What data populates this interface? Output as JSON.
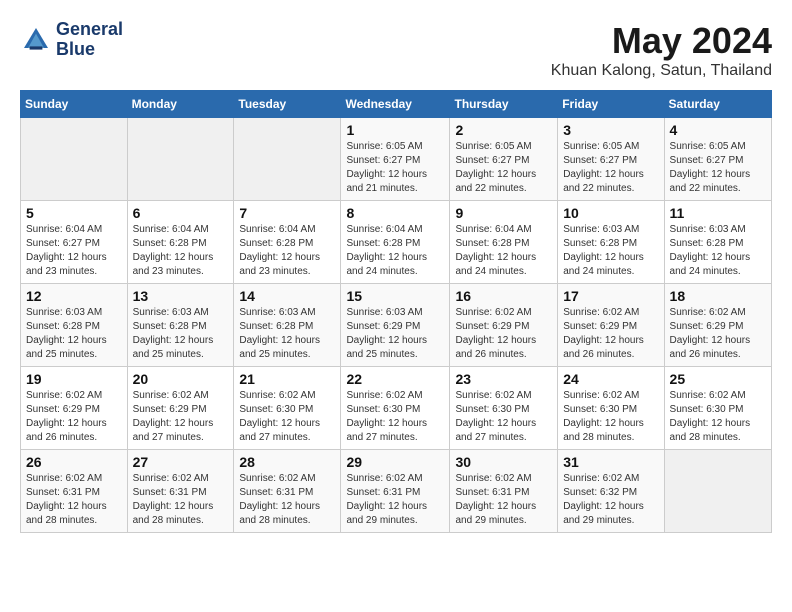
{
  "logo": {
    "line1": "General",
    "line2": "Blue"
  },
  "title": "May 2024",
  "location": "Khuan Kalong, Satun, Thailand",
  "days_of_week": [
    "Sunday",
    "Monday",
    "Tuesday",
    "Wednesday",
    "Thursday",
    "Friday",
    "Saturday"
  ],
  "weeks": [
    [
      {
        "day": "",
        "sunrise": "",
        "sunset": "",
        "daylight": ""
      },
      {
        "day": "",
        "sunrise": "",
        "sunset": "",
        "daylight": ""
      },
      {
        "day": "",
        "sunrise": "",
        "sunset": "",
        "daylight": ""
      },
      {
        "day": "1",
        "sunrise": "Sunrise: 6:05 AM",
        "sunset": "Sunset: 6:27 PM",
        "daylight": "Daylight: 12 hours and 21 minutes."
      },
      {
        "day": "2",
        "sunrise": "Sunrise: 6:05 AM",
        "sunset": "Sunset: 6:27 PM",
        "daylight": "Daylight: 12 hours and 22 minutes."
      },
      {
        "day": "3",
        "sunrise": "Sunrise: 6:05 AM",
        "sunset": "Sunset: 6:27 PM",
        "daylight": "Daylight: 12 hours and 22 minutes."
      },
      {
        "day": "4",
        "sunrise": "Sunrise: 6:05 AM",
        "sunset": "Sunset: 6:27 PM",
        "daylight": "Daylight: 12 hours and 22 minutes."
      }
    ],
    [
      {
        "day": "5",
        "sunrise": "Sunrise: 6:04 AM",
        "sunset": "Sunset: 6:27 PM",
        "daylight": "Daylight: 12 hours and 23 minutes."
      },
      {
        "day": "6",
        "sunrise": "Sunrise: 6:04 AM",
        "sunset": "Sunset: 6:28 PM",
        "daylight": "Daylight: 12 hours and 23 minutes."
      },
      {
        "day": "7",
        "sunrise": "Sunrise: 6:04 AM",
        "sunset": "Sunset: 6:28 PM",
        "daylight": "Daylight: 12 hours and 23 minutes."
      },
      {
        "day": "8",
        "sunrise": "Sunrise: 6:04 AM",
        "sunset": "Sunset: 6:28 PM",
        "daylight": "Daylight: 12 hours and 24 minutes."
      },
      {
        "day": "9",
        "sunrise": "Sunrise: 6:04 AM",
        "sunset": "Sunset: 6:28 PM",
        "daylight": "Daylight: 12 hours and 24 minutes."
      },
      {
        "day": "10",
        "sunrise": "Sunrise: 6:03 AM",
        "sunset": "Sunset: 6:28 PM",
        "daylight": "Daylight: 12 hours and 24 minutes."
      },
      {
        "day": "11",
        "sunrise": "Sunrise: 6:03 AM",
        "sunset": "Sunset: 6:28 PM",
        "daylight": "Daylight: 12 hours and 24 minutes."
      }
    ],
    [
      {
        "day": "12",
        "sunrise": "Sunrise: 6:03 AM",
        "sunset": "Sunset: 6:28 PM",
        "daylight": "Daylight: 12 hours and 25 minutes."
      },
      {
        "day": "13",
        "sunrise": "Sunrise: 6:03 AM",
        "sunset": "Sunset: 6:28 PM",
        "daylight": "Daylight: 12 hours and 25 minutes."
      },
      {
        "day": "14",
        "sunrise": "Sunrise: 6:03 AM",
        "sunset": "Sunset: 6:28 PM",
        "daylight": "Daylight: 12 hours and 25 minutes."
      },
      {
        "day": "15",
        "sunrise": "Sunrise: 6:03 AM",
        "sunset": "Sunset: 6:29 PM",
        "daylight": "Daylight: 12 hours and 25 minutes."
      },
      {
        "day": "16",
        "sunrise": "Sunrise: 6:02 AM",
        "sunset": "Sunset: 6:29 PM",
        "daylight": "Daylight: 12 hours and 26 minutes."
      },
      {
        "day": "17",
        "sunrise": "Sunrise: 6:02 AM",
        "sunset": "Sunset: 6:29 PM",
        "daylight": "Daylight: 12 hours and 26 minutes."
      },
      {
        "day": "18",
        "sunrise": "Sunrise: 6:02 AM",
        "sunset": "Sunset: 6:29 PM",
        "daylight": "Daylight: 12 hours and 26 minutes."
      }
    ],
    [
      {
        "day": "19",
        "sunrise": "Sunrise: 6:02 AM",
        "sunset": "Sunset: 6:29 PM",
        "daylight": "Daylight: 12 hours and 26 minutes."
      },
      {
        "day": "20",
        "sunrise": "Sunrise: 6:02 AM",
        "sunset": "Sunset: 6:29 PM",
        "daylight": "Daylight: 12 hours and 27 minutes."
      },
      {
        "day": "21",
        "sunrise": "Sunrise: 6:02 AM",
        "sunset": "Sunset: 6:30 PM",
        "daylight": "Daylight: 12 hours and 27 minutes."
      },
      {
        "day": "22",
        "sunrise": "Sunrise: 6:02 AM",
        "sunset": "Sunset: 6:30 PM",
        "daylight": "Daylight: 12 hours and 27 minutes."
      },
      {
        "day": "23",
        "sunrise": "Sunrise: 6:02 AM",
        "sunset": "Sunset: 6:30 PM",
        "daylight": "Daylight: 12 hours and 27 minutes."
      },
      {
        "day": "24",
        "sunrise": "Sunrise: 6:02 AM",
        "sunset": "Sunset: 6:30 PM",
        "daylight": "Daylight: 12 hours and 28 minutes."
      },
      {
        "day": "25",
        "sunrise": "Sunrise: 6:02 AM",
        "sunset": "Sunset: 6:30 PM",
        "daylight": "Daylight: 12 hours and 28 minutes."
      }
    ],
    [
      {
        "day": "26",
        "sunrise": "Sunrise: 6:02 AM",
        "sunset": "Sunset: 6:31 PM",
        "daylight": "Daylight: 12 hours and 28 minutes."
      },
      {
        "day": "27",
        "sunrise": "Sunrise: 6:02 AM",
        "sunset": "Sunset: 6:31 PM",
        "daylight": "Daylight: 12 hours and 28 minutes."
      },
      {
        "day": "28",
        "sunrise": "Sunrise: 6:02 AM",
        "sunset": "Sunset: 6:31 PM",
        "daylight": "Daylight: 12 hours and 28 minutes."
      },
      {
        "day": "29",
        "sunrise": "Sunrise: 6:02 AM",
        "sunset": "Sunset: 6:31 PM",
        "daylight": "Daylight: 12 hours and 29 minutes."
      },
      {
        "day": "30",
        "sunrise": "Sunrise: 6:02 AM",
        "sunset": "Sunset: 6:31 PM",
        "daylight": "Daylight: 12 hours and 29 minutes."
      },
      {
        "day": "31",
        "sunrise": "Sunrise: 6:02 AM",
        "sunset": "Sunset: 6:32 PM",
        "daylight": "Daylight: 12 hours and 29 minutes."
      },
      {
        "day": "",
        "sunrise": "",
        "sunset": "",
        "daylight": ""
      }
    ]
  ]
}
